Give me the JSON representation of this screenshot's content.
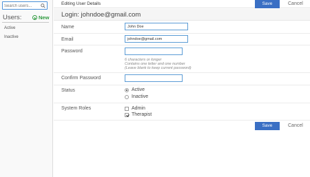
{
  "sidebar": {
    "search": {
      "placeholder": "Search users..."
    },
    "users_label": "Users:",
    "new_label": "New",
    "filters": [
      {
        "label": "Active"
      },
      {
        "label": "Inactive"
      }
    ]
  },
  "header": {
    "title": "Editing User Details",
    "save_label": "Save",
    "cancel_label": "Cancel"
  },
  "login_title": "Login: johndoe@gmail.com",
  "form": {
    "name": {
      "label": "Name",
      "value": "John Doe"
    },
    "email": {
      "label": "Email",
      "value": "johndoe@gmail.com"
    },
    "password": {
      "label": "Password",
      "value": "",
      "hints": [
        "6 characters or longer",
        "Contains one letter and one number",
        "(Leave blank to keep current password)"
      ]
    },
    "confirm_password": {
      "label": "Confirm Password",
      "value": ""
    },
    "status": {
      "label": "Status",
      "options": [
        {
          "label": "Active",
          "selected": true
        },
        {
          "label": "Inactive",
          "selected": false
        }
      ]
    },
    "roles": {
      "label": "System Roles",
      "options": [
        {
          "label": "Admin",
          "checked": false
        },
        {
          "label": "Therapist",
          "checked": true
        }
      ]
    }
  },
  "footer": {
    "save_label": "Save",
    "cancel_label": "Cancel"
  },
  "colors": {
    "accent": "#3a6fc4",
    "new_link": "#2e9a3e",
    "input_border": "#5a9bd5"
  },
  "icons": {
    "search": "search-icon",
    "new": "plus-circle-icon"
  }
}
